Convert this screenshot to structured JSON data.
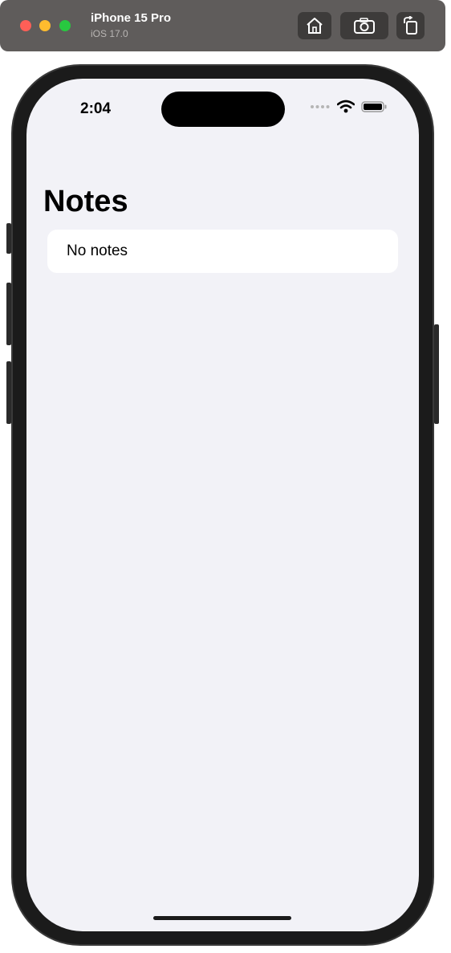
{
  "simulator": {
    "device_name": "iPhone 15 Pro",
    "os_version": "iOS 17.0",
    "buttons": {
      "home_icon": "home-icon",
      "screenshot_icon": "camera-icon",
      "rotate_icon": "rotate-icon"
    }
  },
  "status_bar": {
    "time": "2:04",
    "icons": [
      "cellular-dots-icon",
      "wifi-icon",
      "battery-icon"
    ]
  },
  "screen": {
    "title": "Notes",
    "list": {
      "empty_text": "No notes"
    }
  },
  "colors": {
    "screen_background": "#f2f2f7",
    "card_background": "#ffffff",
    "toolbar_background": "#5f5c5b"
  }
}
